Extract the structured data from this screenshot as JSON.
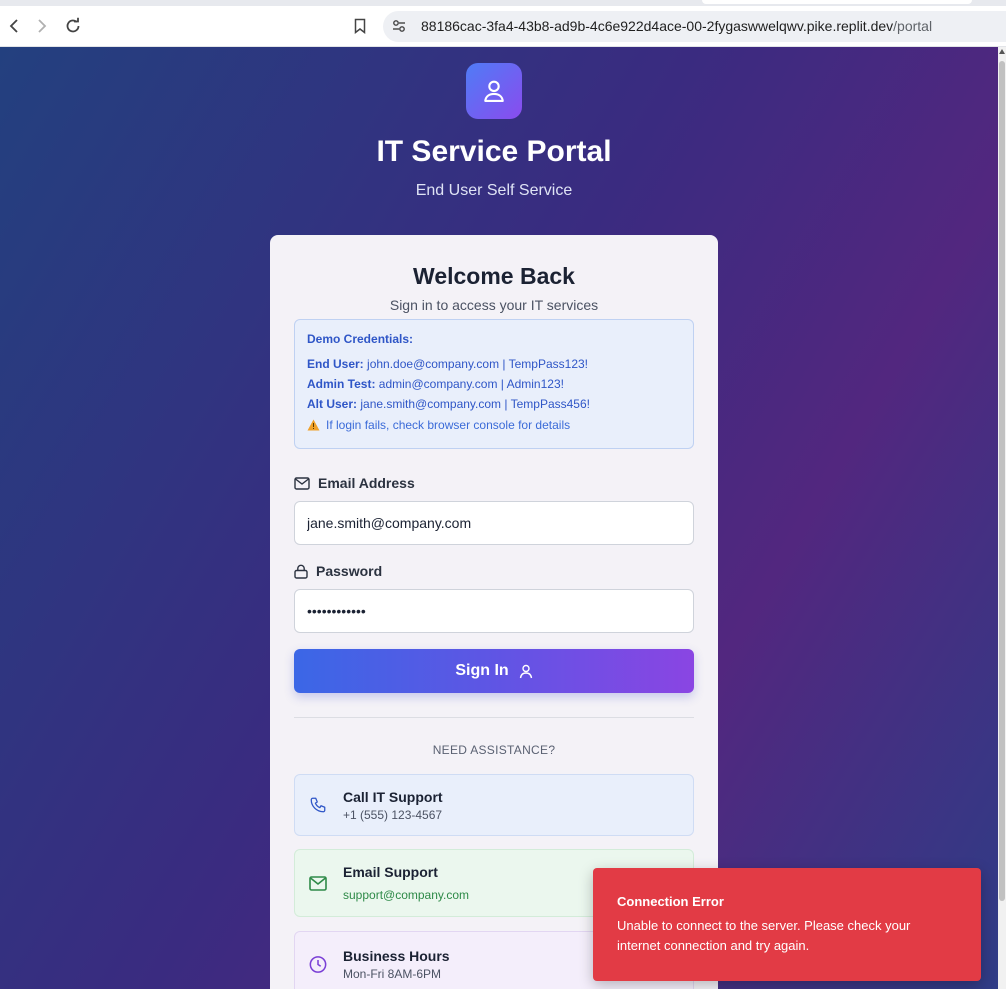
{
  "browser": {
    "url_host": "88186cac-3fa4-43b8-ad9b-4c6e922d4ace-00-2fygaswwelqwv.pike.replit.dev",
    "url_path": "/portal"
  },
  "portal": {
    "title": "IT Service Portal",
    "subtitle": "End User Self Service"
  },
  "login": {
    "heading": "Welcome Back",
    "subheading": "Sign in to access your IT services",
    "demo": {
      "title": "Demo Credentials:",
      "lines": [
        {
          "label": "End User:",
          "value": "john.doe@company.com | TempPass123!"
        },
        {
          "label": "Admin Test:",
          "value": "admin@company.com | Admin123!"
        },
        {
          "label": "Alt User:",
          "value": "jane.smith@company.com | TempPass456!"
        }
      ],
      "warning": "If login fails, check browser console for details"
    },
    "email_label": "Email Address",
    "email_value": "jane.smith@company.com",
    "password_label": "Password",
    "password_value": "••••••••••••",
    "submit_label": "Sign In"
  },
  "assistance": {
    "heading": "NEED ASSISTANCE?",
    "items": [
      {
        "title": "Call IT Support",
        "detail": "+1 (555) 123-4567"
      },
      {
        "title": "Email Support",
        "detail": "support@company.com"
      },
      {
        "title": "Business Hours",
        "detail": "Mon-Fri 8AM-6PM"
      }
    ]
  },
  "toast": {
    "title": "Connection Error",
    "message": "Unable to connect to the server. Please check your internet connection and try again."
  },
  "colors": {
    "accent_blue": "#3b67e6",
    "accent_purple": "#8a45e3",
    "error": "#e23b45"
  }
}
